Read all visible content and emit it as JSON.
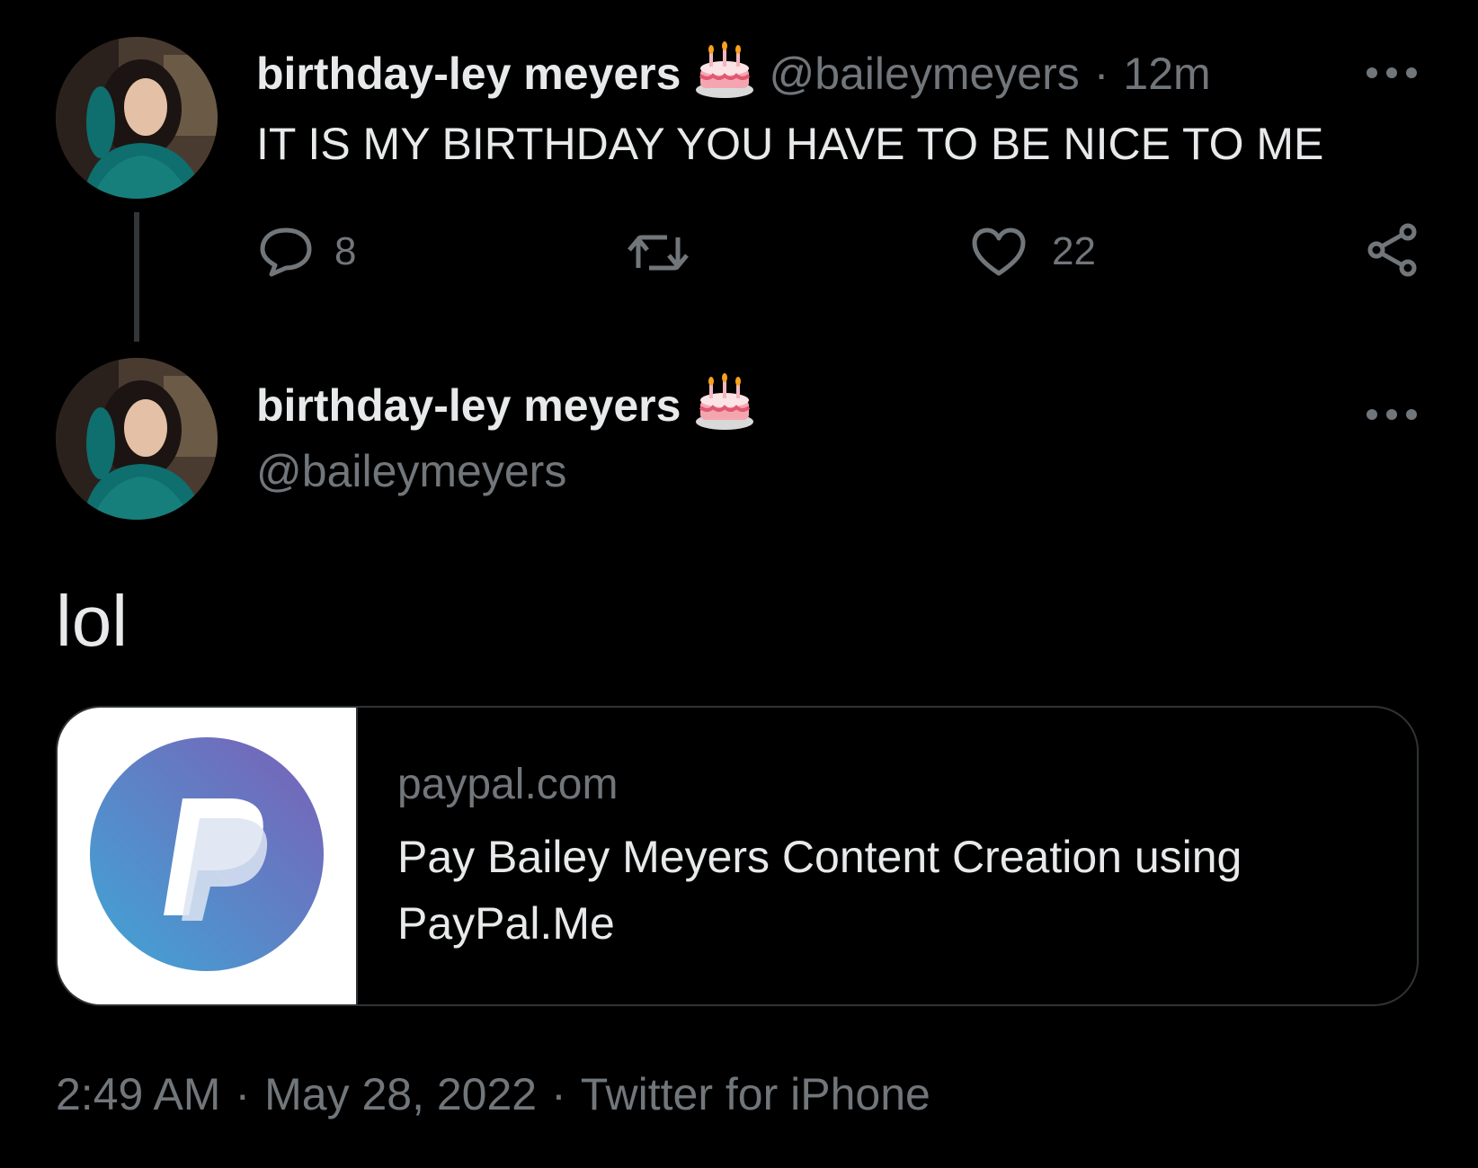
{
  "tweet1": {
    "display_name": "birthday-ley meyers",
    "name_emoji_icon": "birthday-cake-icon",
    "handle": "@baileymeyers",
    "separator": "·",
    "time_ago": "12m",
    "text": "IT IS MY BIRTHDAY YOU HAVE TO BE NICE TO ME",
    "more_label": "•••",
    "actions": {
      "reply_icon": "reply-icon",
      "reply_count": "8",
      "retweet_icon": "retweet-icon",
      "like_icon": "heart-icon",
      "like_count": "22",
      "share_icon": "share-icon"
    }
  },
  "tweet2": {
    "display_name": "birthday-ley meyers",
    "name_emoji_icon": "birthday-cake-icon",
    "handle": "@baileymeyers",
    "more_label": "•••",
    "text": "lol",
    "card": {
      "thumb_icon": "paypal-logo",
      "domain": "paypal.com",
      "title": "Pay Bailey Meyers Content Creation using PayPal.Me"
    },
    "meta": {
      "time": "2:49 AM",
      "sep1": "·",
      "date": "May 28, 2022",
      "sep2": "·",
      "source": "Twitter for iPhone"
    }
  },
  "colors": {
    "background": "#000000",
    "text_primary": "#e7e9ea",
    "text_muted": "#71767b",
    "border": "#2f3336"
  }
}
